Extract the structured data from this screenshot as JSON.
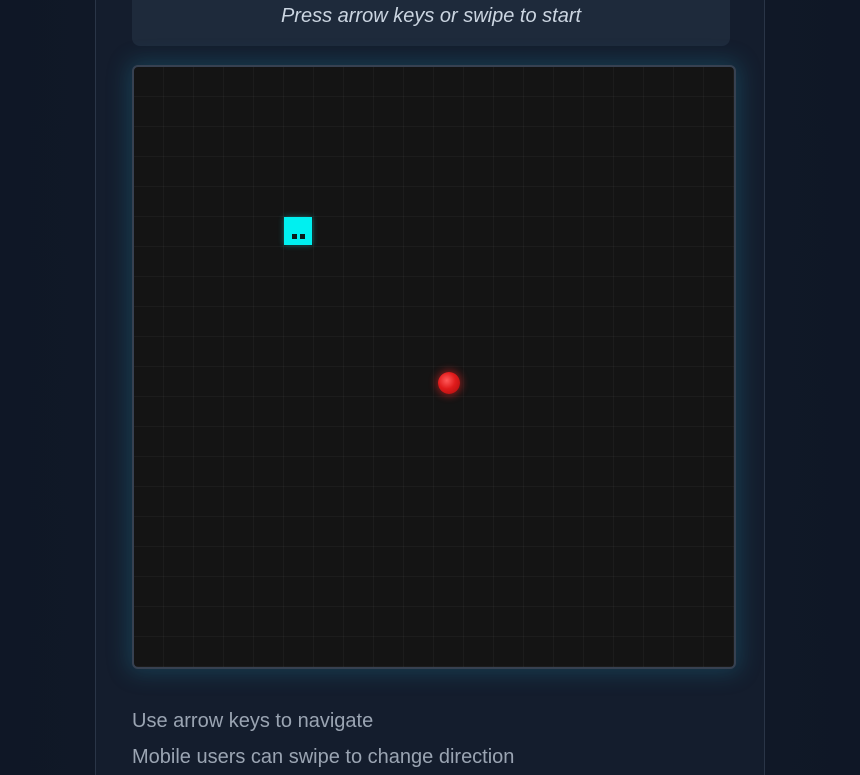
{
  "status": {
    "message": "Press arrow keys or swipe to start"
  },
  "game": {
    "grid": {
      "cols": 20,
      "rows": 20
    },
    "snake": [
      {
        "col": 5,
        "row": 5,
        "part": "head",
        "direction": "down"
      }
    ],
    "food": {
      "col": 10,
      "row": 10
    },
    "colors": {
      "snake": "#00f0f0",
      "food": "#e01b1b",
      "board": "#141414",
      "board_glow": "#228caa"
    }
  },
  "instructions": {
    "line1": "Use arrow keys to navigate",
    "line2": "Mobile users can swipe to change direction"
  }
}
